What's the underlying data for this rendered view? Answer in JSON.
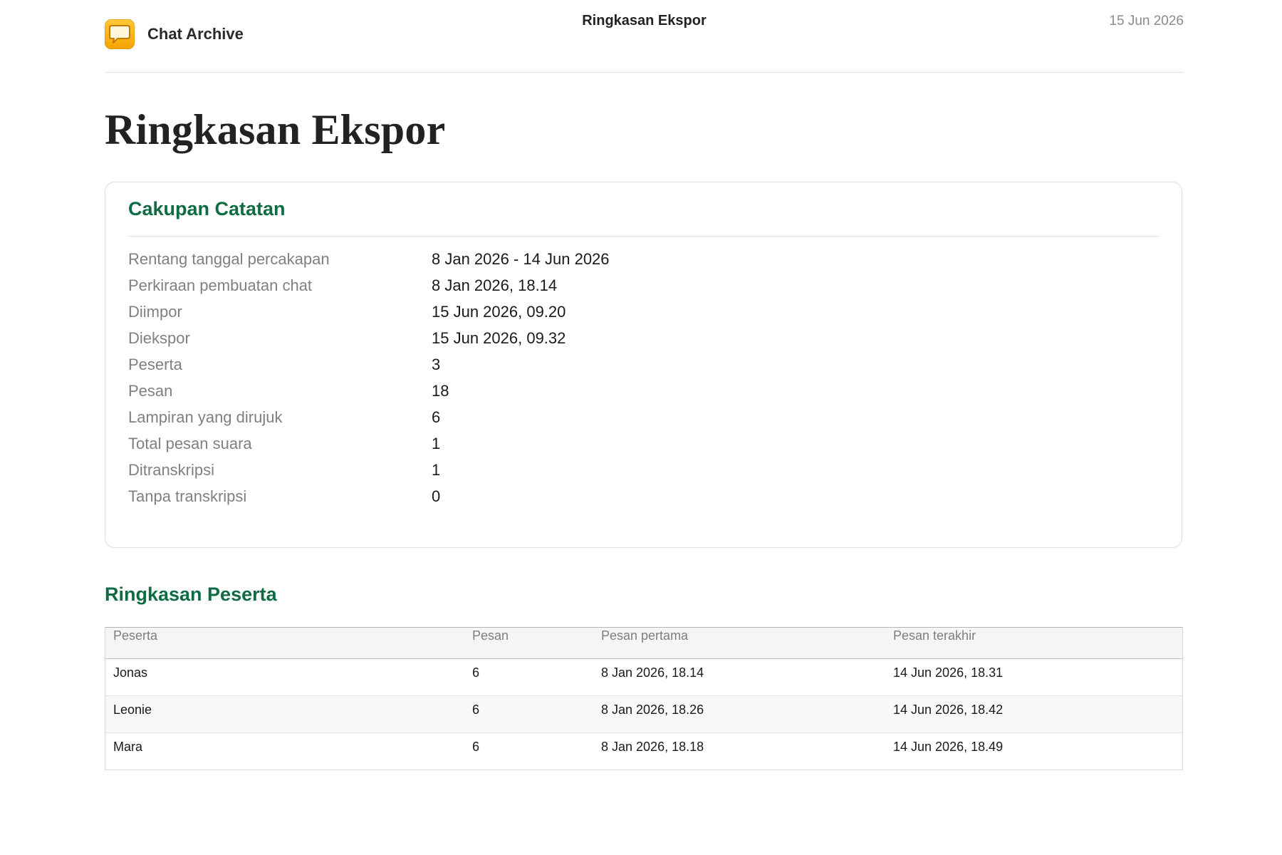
{
  "header": {
    "app_name": "Chat Archive",
    "icon": "chat-bubble-icon",
    "title": "Ringkasan Ekspor",
    "date": "15 Jun 2026"
  },
  "page_title": "Ringkasan Ekspor",
  "coverage": {
    "title": "Cakupan Catatan",
    "rows": [
      {
        "label": "Rentang tanggal percakapan",
        "value": "8 Jan 2026 - 14 Jun 2026"
      },
      {
        "label": "Perkiraan pembuatan chat",
        "value": "8 Jan 2026, 18.14"
      },
      {
        "label": "Diimpor",
        "value": "15 Jun 2026, 09.20"
      },
      {
        "label": "Diekspor",
        "value": "15 Jun 2026, 09.32"
      },
      {
        "label": "Peserta",
        "value": "3"
      },
      {
        "label": "Pesan",
        "value": "18"
      },
      {
        "label": "Lampiran yang dirujuk",
        "value": "6"
      },
      {
        "label": "Total pesan suara",
        "value": "1"
      },
      {
        "label": "Ditranskripsi",
        "value": "1"
      },
      {
        "label": "Tanpa transkripsi",
        "value": "0"
      }
    ]
  },
  "participants": {
    "title": "Ringkasan Peserta",
    "columns": [
      "Peserta",
      "Pesan",
      "Pesan pertama",
      "Pesan terakhir"
    ],
    "rows": [
      {
        "name": "Jonas",
        "messages": "6",
        "first": "8 Jan 2026, 18.14",
        "last": "14 Jun 2026, 18.31"
      },
      {
        "name": "Leonie",
        "messages": "6",
        "first": "8 Jan 2026, 18.26",
        "last": "14 Jun 2026, 18.42"
      },
      {
        "name": "Mara",
        "messages": "6",
        "first": "8 Jan 2026, 18.18",
        "last": "14 Jun 2026, 18.49"
      }
    ]
  },
  "colors": {
    "accent_green": "#0e6b43",
    "icon_yellow": "#f6a400"
  }
}
